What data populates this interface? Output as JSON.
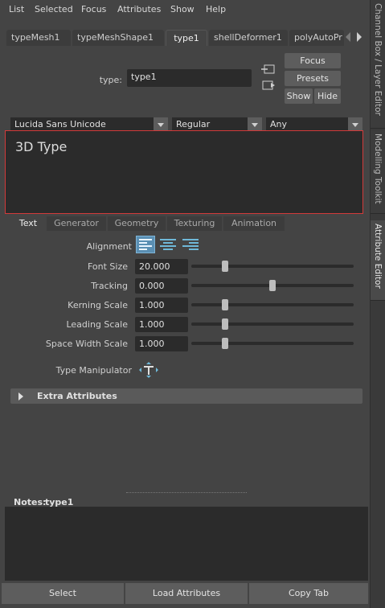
{
  "menu": [
    "List",
    "Selected",
    "Focus",
    "Attributes",
    "Show",
    "Help"
  ],
  "side_tabs": [
    "Channel Box / Layer Editor",
    "Modelling Toolkit",
    "Attribute Editor"
  ],
  "node_tabs": [
    "typeMesh1",
    "typeMeshShape1",
    "type1",
    "shellDeformer1",
    "polyAutoPr"
  ],
  "active_node_tab": "type1",
  "type_row": {
    "label": "type:",
    "value": "type1"
  },
  "buttons": {
    "focus": "Focus",
    "presets": "Presets",
    "show": "Show",
    "hide": "Hide"
  },
  "font": {
    "family": "Lucida Sans Unicode",
    "style": "Regular",
    "writing_system": "Any"
  },
  "text_content": "3D Type",
  "section_tabs": [
    "Text",
    "Generator",
    "Geometry",
    "Texturing",
    "Animation"
  ],
  "active_section_tab": "Text",
  "attributes": {
    "alignment_label": "Alignment",
    "alignment_active": "left",
    "rows": [
      {
        "label": "Font Size",
        "value": "20.000",
        "slider": 0.21
      },
      {
        "label": "Tracking",
        "value": "0.000",
        "slider": 0.5
      },
      {
        "label": "Kerning Scale",
        "value": "1.000",
        "slider": 0.21
      },
      {
        "label": "Leading Scale",
        "value": "1.000",
        "slider": 0.21
      },
      {
        "label": "Space Width Scale",
        "value": "1.000",
        "slider": 0.21
      }
    ],
    "manipulator_label": "Type Manipulator"
  },
  "extra_attributes": "Extra Attributes",
  "notes": {
    "label": "Notes:",
    "node": "type1"
  },
  "bottom_buttons": {
    "select": "Select",
    "load": "Load Attributes",
    "copy": "Copy Tab"
  },
  "colors": {
    "accent": "#5a8fb3",
    "highlight_border": "#d23a3a",
    "panel": "#444444",
    "field": "#2b2b2b"
  }
}
